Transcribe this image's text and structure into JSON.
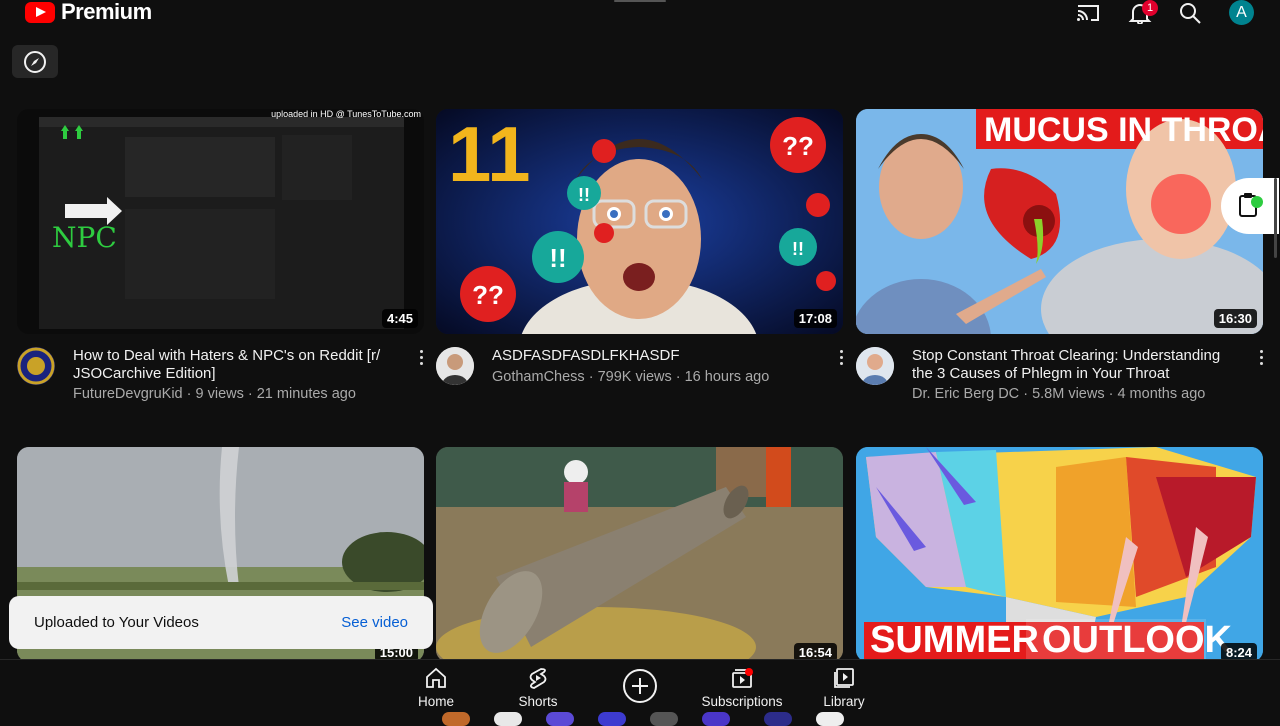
{
  "header": {
    "brand": "Premium",
    "notifications_count": "1",
    "account_initial": "A",
    "icons": [
      "cast-icon",
      "bell-icon",
      "search-icon"
    ]
  },
  "explore": {
    "icon": "compass-icon"
  },
  "videos": [
    {
      "title": "How to Deal with Haters & NPC's on Reddit [r/ JSOCarchive Edition]",
      "channel": "FutureDevgruKid",
      "meta": "9 views · 21 minutes ago",
      "duration": "4:45",
      "thumb_caption": "uploaded in HD @ TunesToTube.com",
      "thumb_label": "NPC"
    },
    {
      "title": "ASDFASDFASDLFKHASDF",
      "channel": "GothamChess",
      "meta": "799K views · 16 hours ago",
      "duration": "17:08",
      "thumb_big_number": "11"
    },
    {
      "title": "Stop Constant Throat Clearing: Understanding the 3 Causes of Phlegm in Your Throat",
      "channel": "Dr. Eric Berg DC",
      "meta": "5.8M views · 4 months ago",
      "duration": "16:30",
      "thumb_banner": "MUCUS IN THROAT"
    },
    {
      "duration": "15:00"
    },
    {
      "duration": "16:54"
    },
    {
      "duration": "8:24",
      "thumb_left": "SUMMER",
      "thumb_right": "OUTLOOK"
    }
  ],
  "toast": {
    "message": "Uploaded to Your Videos",
    "action": "See video"
  },
  "nav": {
    "home": "Home",
    "shorts": "Shorts",
    "subscriptions": "Subscriptions",
    "library": "Library"
  },
  "colors": {
    "brand_red": "#ff0000",
    "link_blue": "#065fd4",
    "background": "#0f0f0f"
  }
}
